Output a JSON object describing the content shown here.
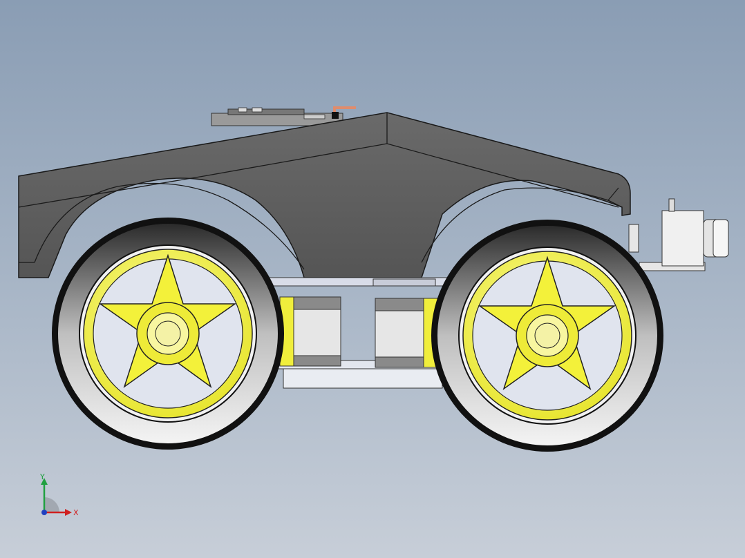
{
  "viewport": {
    "background_top": "#8a9db4",
    "background_bottom": "#c7ced8"
  },
  "model": {
    "description_icon": "robot-car-model",
    "body_color": "#5a5a5a",
    "rim_color": "#f2f03c",
    "tire_color": "#1a1a1a",
    "motor_color": "#e6e6e6",
    "chassis_plate_color": "#d8dce8"
  },
  "triad": {
    "x_label": "X",
    "y_label": "Y",
    "x_color": "#d02020",
    "y_color": "#20a040",
    "z_color": "#2040c0"
  }
}
